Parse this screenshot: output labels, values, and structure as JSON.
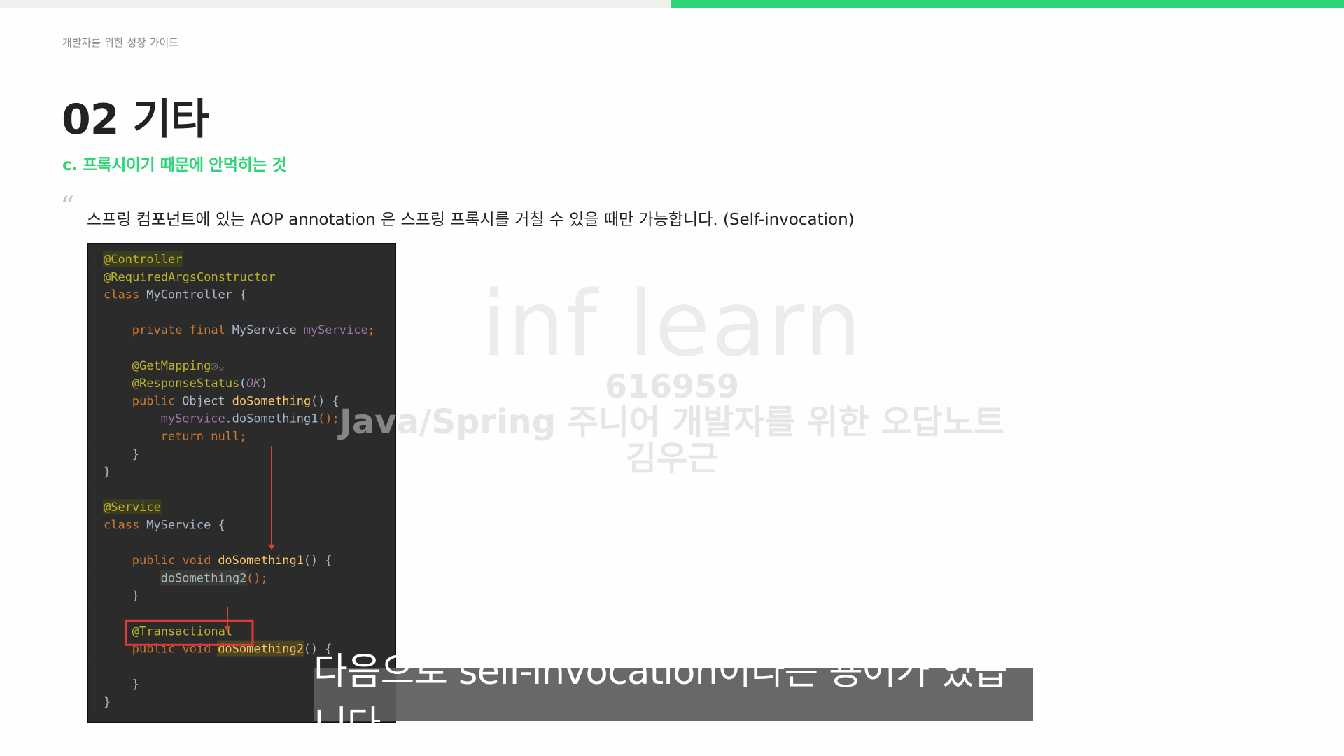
{
  "progress": {
    "fraction": 0.5,
    "color": "#2ed477"
  },
  "colors": {
    "accent": "#2ed477",
    "highlight_box": "#e03a3a",
    "arrow": "#d9423b"
  },
  "slide": {
    "breadcrumb": "개발자를 위한 성장 가이드",
    "title": "02 기타",
    "subtitle": "c. 프록시이기 때문에 안먹히는 것",
    "quote_mark": "“",
    "quote": "스프링 컴포넌트에 있는 AOP annotation 은 스프링 프록시를 거칠 수 있을 때만 가능합니다. (Self-invocation)"
  },
  "code": {
    "lines": [
      [
        {
          "t": "@Controller",
          "c": "ann",
          "bg": "#3b3b1f"
        }
      ],
      [
        {
          "t": "@RequiredArgsConstructor",
          "c": "ann"
        }
      ],
      [
        {
          "t": "class ",
          "c": "kw"
        },
        {
          "t": "MyController {",
          "c": "txt"
        }
      ],
      [],
      [
        {
          "t": "    private final ",
          "c": "kw"
        },
        {
          "t": "MyService ",
          "c": "txt"
        },
        {
          "t": "myService",
          "c": "fld"
        },
        {
          "t": ";",
          "c": "kw"
        }
      ],
      [],
      [
        {
          "t": "    @GetMapping",
          "c": "ann"
        },
        {
          "t": "◎⌄",
          "c": "gut"
        }
      ],
      [
        {
          "t": "    @ResponseStatus",
          "c": "ann"
        },
        {
          "t": "(",
          "c": "txt"
        },
        {
          "t": "OK",
          "c": "cst"
        },
        {
          "t": ")",
          "c": "txt"
        }
      ],
      [
        {
          "t": "    public ",
          "c": "kw"
        },
        {
          "t": "Object ",
          "c": "txt"
        },
        {
          "t": "doSomething",
          "c": "fn"
        },
        {
          "t": "() {",
          "c": "txt"
        }
      ],
      [
        {
          "t": "        myService",
          "c": "fld"
        },
        {
          "t": ".doSomething1",
          "c": "txt"
        },
        {
          "t": "();",
          "c": "kw"
        }
      ],
      [
        {
          "t": "        return null;",
          "c": "kw"
        }
      ],
      [
        {
          "t": "    }",
          "c": "txt"
        }
      ],
      [
        {
          "t": "}",
          "c": "txt"
        }
      ],
      [],
      [
        {
          "t": "@Service",
          "c": "ann",
          "bg": "#3b3b1f"
        }
      ],
      [
        {
          "t": "class ",
          "c": "kw"
        },
        {
          "t": "MyService {",
          "c": "txt"
        }
      ],
      [],
      [
        {
          "t": "    public void ",
          "c": "kw"
        },
        {
          "t": "doSomething1",
          "c": "fn"
        },
        {
          "t": "() {",
          "c": "txt"
        }
      ],
      [
        {
          "t": "        doSomething2",
          "c": "txt",
          "bg": "#3a3a35"
        },
        {
          "t": "();",
          "c": "kw"
        }
      ],
      [
        {
          "t": "    }",
          "c": "txt"
        }
      ],
      [],
      [
        {
          "t": "    @Transactional",
          "c": "ann"
        }
      ],
      [
        {
          "t": "    public void ",
          "c": "kw"
        },
        {
          "t": "doSomething2",
          "c": "fn",
          "bg": "#4d4420"
        },
        {
          "t": "() {",
          "c": "txt"
        }
      ],
      [],
      [
        {
          "t": "    }",
          "c": "txt"
        }
      ],
      [
        {
          "t": "}",
          "c": "txt"
        }
      ]
    ]
  },
  "watermark": {
    "logo": "inf learn",
    "id": "616959",
    "course": "Java/Spring 주니어 개발자를 위한 오답노트",
    "author": "김우근"
  },
  "caption": "다음으로 self-invocation이라는 용어가 있습니다"
}
